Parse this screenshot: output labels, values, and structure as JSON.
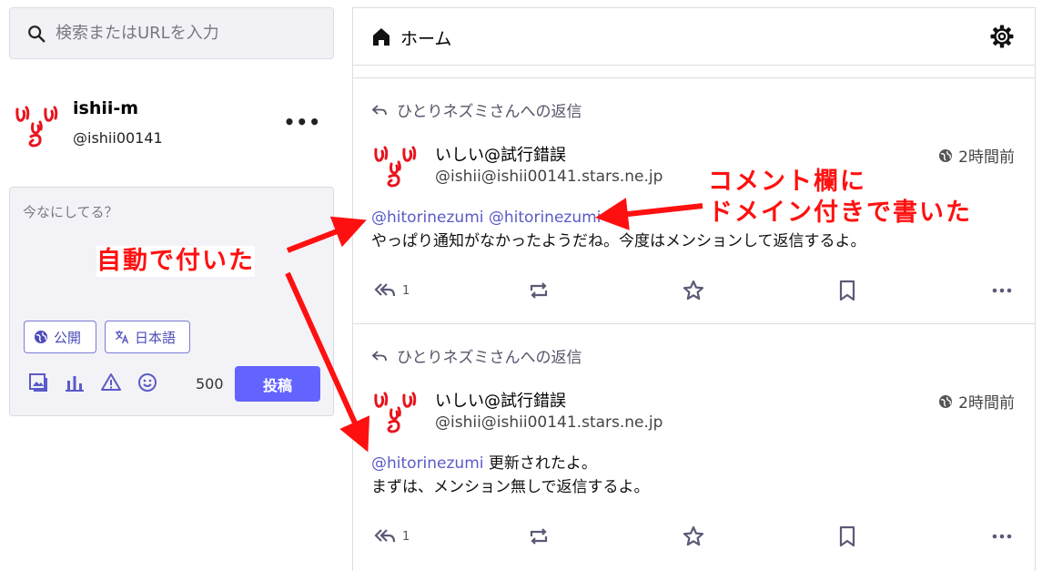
{
  "search": {
    "placeholder": "検索またはURLを入力",
    "icon": "search-icon"
  },
  "account": {
    "name": "ishii-m",
    "handle": "@ishii00141",
    "menu": "•••"
  },
  "composer": {
    "placeholder": "今なにしてる？",
    "visibility_label": "公開",
    "language_label": "日本語",
    "char_count": "500",
    "post_label": "投稿",
    "tools": [
      "media-icon",
      "poll-icon",
      "warning-icon",
      "emoji-icon"
    ]
  },
  "timeline": {
    "title": "ホーム",
    "statuses": [
      {
        "reply_to": "ひとりネズミさんへの返信",
        "display_name": "いしい@試行錯誤",
        "acct": "@ishii@ishii00141.stars.ne.jp",
        "time": "2時間前",
        "mentions": "@hitorinezumi @hitorinezumi",
        "text_inline": "",
        "text": "やっぱり通知がなかったようだね。今度はメンションして返信するよ。",
        "reply_count": "1"
      },
      {
        "reply_to": "ひとりネズミさんへの返信",
        "display_name": "いしい@試行錯誤",
        "acct": "@ishii@ishii00141.stars.ne.jp",
        "time": "2時間前",
        "mentions": "@hitorinezumi",
        "text_inline": " 更新されたよ。",
        "text": "まずは、メンション無しで返信するよ。",
        "reply_count": "1"
      }
    ]
  },
  "annotations": {
    "auto": "自動で付いた",
    "comment_line1": "コメント欄に",
    "comment_line2": "ドメイン付きで書いた"
  },
  "colors": {
    "accent": "#6364ff",
    "mention": "#5a5ac8",
    "annotation": "#ff1010",
    "avatar": "#e8141e"
  }
}
